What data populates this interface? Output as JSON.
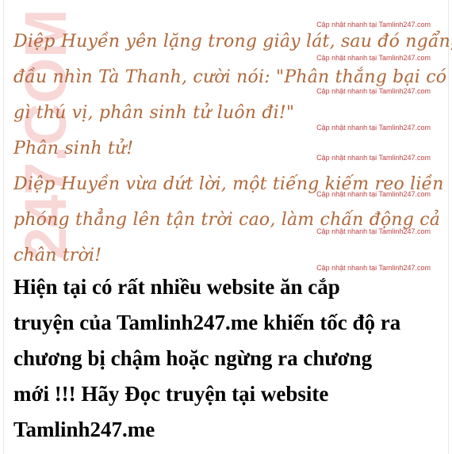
{
  "watermark": {
    "vertical_text": "247.COM"
  },
  "story": {
    "lines": [
      "Diệp Huyền yên lặng trong giây lát, sau đó ngẩng",
      "đầu nhìn Tà Thanh, cười nói: \"Phân thắng bại có",
      "gì thú vị, phân sinh tử luôn đi!\"",
      "Phân sinh tử!",
      "Diệp Huyền vừa dứt lời, một tiếng kiếm reo liền",
      "phóng thẳng lên tận trời cao, làm chấn động cả",
      "chân trời!"
    ]
  },
  "stamps": {
    "text": "Cập nhật nhanh tại Tamlinh247.com"
  },
  "notice": {
    "lines": [
      "Hiện tại có rất nhiều website ăn cắp",
      "truyện của Tamlinh247.me khiến tốc độ ra",
      "chương bị chậm hoặc ngừng ra chương",
      "mới !!! Hãy Đọc truyện tại website",
      "Tamlinh247.me"
    ]
  },
  "colors": {
    "story_text": "#b0683a",
    "stamp_text": "#c04040",
    "notice_text": "#000000",
    "watermark": "#f3b8b8"
  }
}
